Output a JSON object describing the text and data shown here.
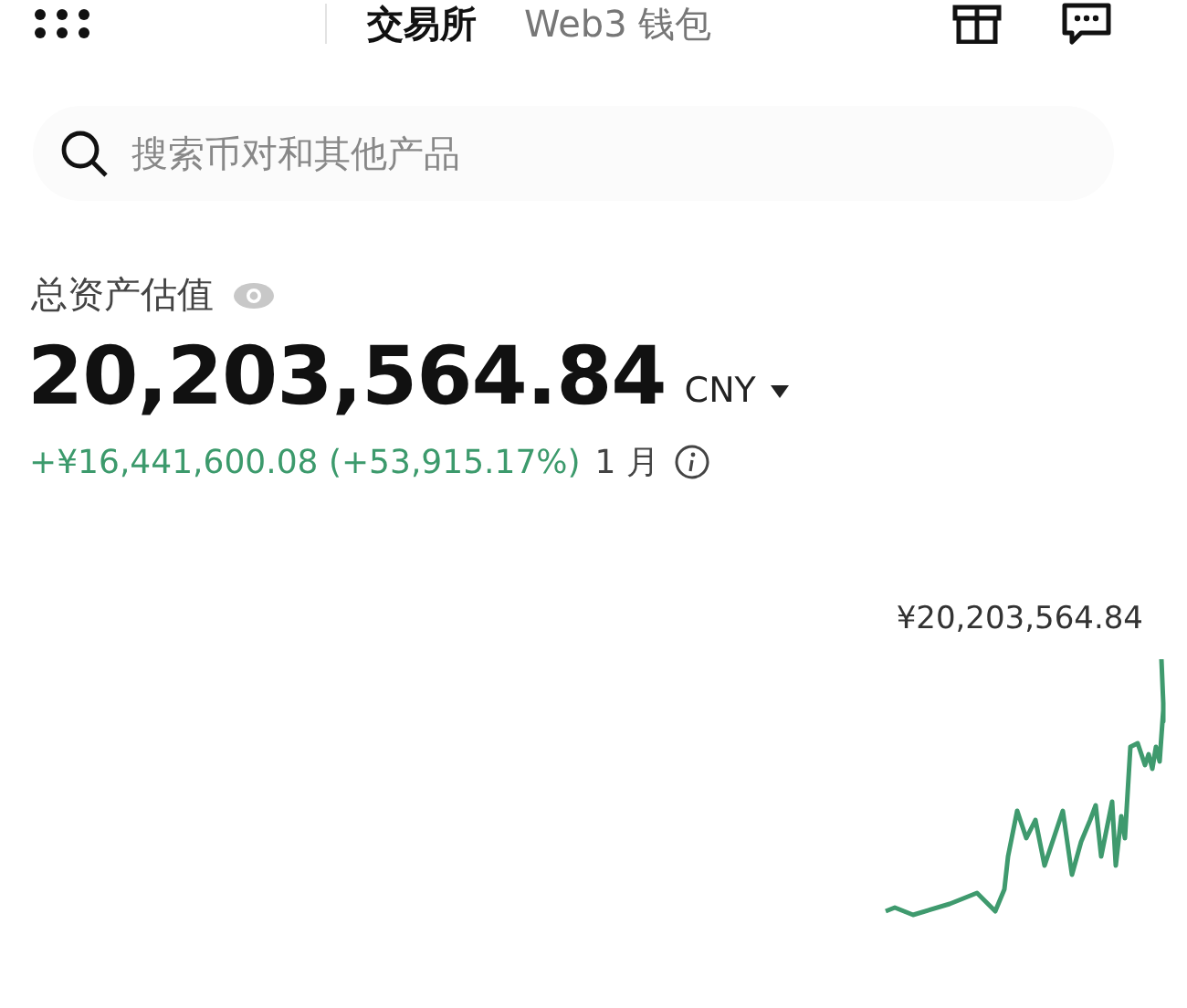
{
  "tabs": [
    {
      "label": "交易所",
      "selected": true
    },
    {
      "label": "Web3 钱包",
      "selected": false
    }
  ],
  "search": {
    "placeholder": "搜索币对和其他产品"
  },
  "assets": {
    "label": "总资产估值",
    "amount": "20,203,564.84",
    "currency": "CNY",
    "change": "+¥16,441,600.08 (+53,915.17%)",
    "period": "1 月"
  },
  "chart": {
    "peak_label": "¥20,203,564.84"
  }
}
